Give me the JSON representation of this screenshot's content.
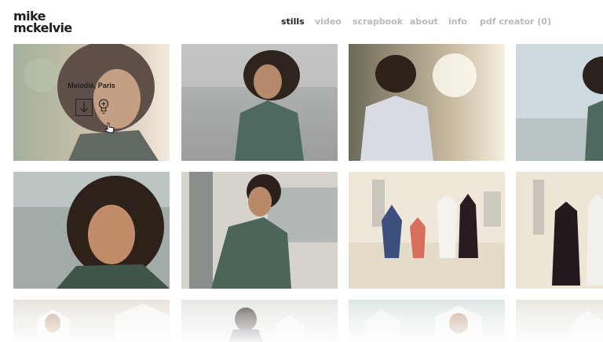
{
  "brand": {
    "line1": "mike",
    "line2": "mckelvie"
  },
  "nav": [
    {
      "label": "stills",
      "active": true
    },
    {
      "label": "video",
      "active": false
    },
    {
      "label": "scrapbook",
      "active": false
    },
    {
      "label": "about",
      "active": false
    },
    {
      "label": "info",
      "active": false
    },
    {
      "label": "pdf creator (0)",
      "active": false
    }
  ],
  "hover_overlay": {
    "title": "Melodié, Paris",
    "actions": [
      "download-icon",
      "lightbulb-icon"
    ]
  },
  "colors": {
    "active_nav": "#1e1e1e",
    "inactive_nav": "#b9b9b9",
    "background": "#ffffff"
  }
}
